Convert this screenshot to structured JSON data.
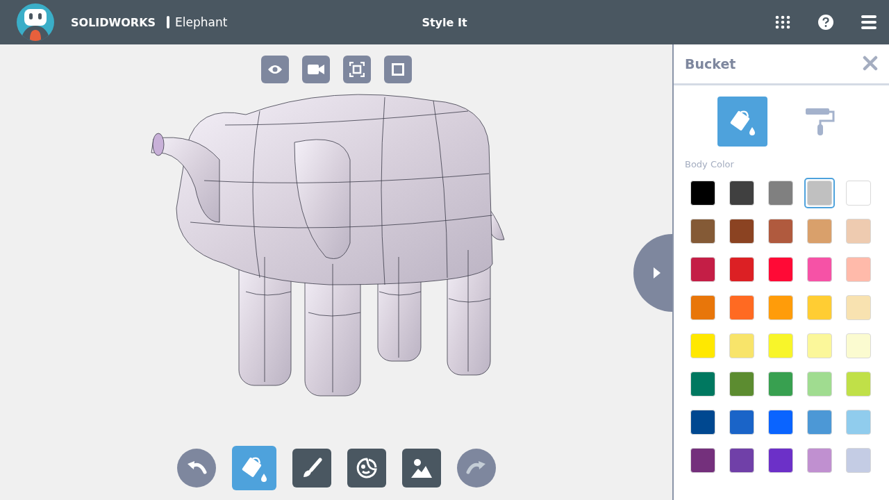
{
  "header": {
    "brand": "SOLIDWORKS",
    "document": "Elephant",
    "title": "Style It"
  },
  "view_tools": [
    {
      "kind": "eye"
    },
    {
      "kind": "camera"
    },
    {
      "kind": "fit"
    },
    {
      "kind": "square"
    }
  ],
  "bottom_tools": [
    {
      "kind": "undo",
      "selected": false,
      "disabled": false
    },
    {
      "kind": "bucket",
      "selected": true,
      "disabled": false
    },
    {
      "kind": "brush",
      "selected": false,
      "disabled": false
    },
    {
      "kind": "sticker",
      "selected": false,
      "disabled": false
    },
    {
      "kind": "image",
      "selected": false,
      "disabled": false
    },
    {
      "kind": "redo",
      "selected": false,
      "disabled": true
    }
  ],
  "panel": {
    "title": "Bucket",
    "modes": [
      {
        "kind": "bucket",
        "selected": true
      },
      {
        "kind": "roller",
        "selected": false
      }
    ],
    "section_label": "Body Color",
    "swatches": [
      {
        "color": "#000000",
        "selected": false
      },
      {
        "color": "#404040",
        "selected": false
      },
      {
        "color": "#808080",
        "selected": false
      },
      {
        "color": "#c0c0c0",
        "selected": true
      },
      {
        "color": "#ffffff",
        "selected": false
      },
      {
        "color": "#845a36",
        "selected": false
      },
      {
        "color": "#8b4322",
        "selected": false
      },
      {
        "color": "#b05a3e",
        "selected": false
      },
      {
        "color": "#d9a06b",
        "selected": false
      },
      {
        "color": "#eecbb0",
        "selected": false
      },
      {
        "color": "#c41e46",
        "selected": false
      },
      {
        "color": "#dc2024",
        "selected": false
      },
      {
        "color": "#ff0a36",
        "selected": false
      },
      {
        "color": "#f652a6",
        "selected": false
      },
      {
        "color": "#ffbaaa",
        "selected": false
      },
      {
        "color": "#e8760a",
        "selected": false
      },
      {
        "color": "#ff6a22",
        "selected": false
      },
      {
        "color": "#ff9c0a",
        "selected": false
      },
      {
        "color": "#ffcd33",
        "selected": false
      },
      {
        "color": "#f8e2b0",
        "selected": false
      },
      {
        "color": "#ffe800",
        "selected": false
      },
      {
        "color": "#f8e46a",
        "selected": false
      },
      {
        "color": "#f8f52a",
        "selected": false
      },
      {
        "color": "#fbf79a",
        "selected": false
      },
      {
        "color": "#fbfbd0",
        "selected": false
      },
      {
        "color": "#007860",
        "selected": false
      },
      {
        "color": "#5c8c30",
        "selected": false
      },
      {
        "color": "#38a050",
        "selected": false
      },
      {
        "color": "#a0dc90",
        "selected": false
      },
      {
        "color": "#c0e048",
        "selected": false
      },
      {
        "color": "#004890",
        "selected": false
      },
      {
        "color": "#1a64c8",
        "selected": false
      },
      {
        "color": "#0a64ff",
        "selected": false
      },
      {
        "color": "#4c98d6",
        "selected": false
      },
      {
        "color": "#90cced",
        "selected": false
      },
      {
        "color": "#74307c",
        "selected": false
      },
      {
        "color": "#7040a8",
        "selected": false
      },
      {
        "color": "#6c30c8",
        "selected": false
      },
      {
        "color": "#c090d0",
        "selected": false
      },
      {
        "color": "#c4cce4",
        "selected": false
      }
    ]
  }
}
